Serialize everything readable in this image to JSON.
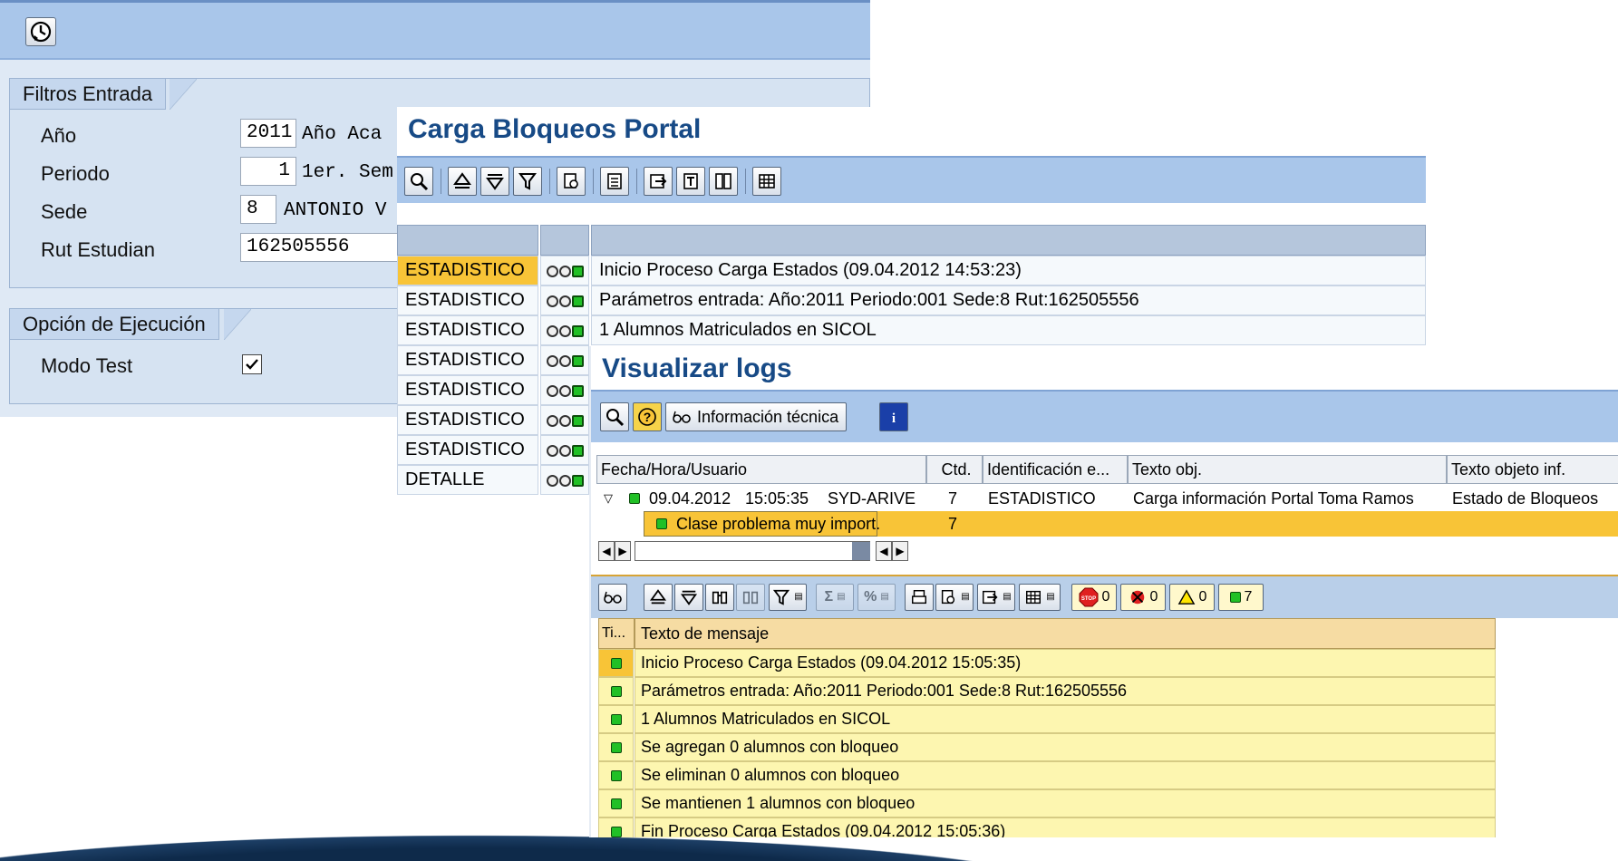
{
  "selection_screen": {
    "group1_title": "Filtros Entrada",
    "fields": [
      {
        "label": "Año",
        "value": "2011",
        "desc": "Año Aca"
      },
      {
        "label": "Periodo",
        "value": "1",
        "desc": "1er. Sem"
      },
      {
        "label": "Sede",
        "value": "8",
        "desc": "ANTONIO V"
      },
      {
        "label": "Rut Estudian",
        "value": "162505556",
        "desc": ""
      }
    ],
    "group2_title": "Opción de Ejecución",
    "mode_label": "Modo Test",
    "mode_checked": true
  },
  "carga": {
    "title": "Carga Bloqueos Portal",
    "rows": [
      {
        "cat": "ESTADISTICO",
        "text": "Inicio Proceso Carga Estados (09.04.2012 14:53:23)",
        "selected": true
      },
      {
        "cat": "ESTADISTICO",
        "text": "Parámetros entrada: Año:2011 Periodo:001 Sede:8 Rut:162505556"
      },
      {
        "cat": "ESTADISTICO",
        "text": "1 Alumnos Matriculados en SICOL"
      },
      {
        "cat": "ESTADISTICO",
        "text": ""
      },
      {
        "cat": "ESTADISTICO",
        "text": ""
      },
      {
        "cat": "ESTADISTICO",
        "text": ""
      },
      {
        "cat": "ESTADISTICO",
        "text": ""
      },
      {
        "cat": "DETALLE",
        "text": ""
      }
    ]
  },
  "logs": {
    "title": "Visualizar logs",
    "tech_info_label": "Información técnica",
    "columns": [
      "Fecha/Hora/Usuario",
      "Ctd.",
      "Identificación e...",
      "Texto obj.",
      "Texto objeto inf."
    ],
    "row1": {
      "date": "09.04.2012",
      "time": "15:05:35",
      "user": "SYD-ARIVE",
      "qty": "7",
      "id": "ESTADISTICO",
      "obj": "Carga información Portal Toma Ramos",
      "objinf": "Estado de Bloqueos"
    },
    "row2": {
      "label": "Clase problema muy import.",
      "qty": "7"
    },
    "counters": {
      "stop": "0",
      "error": "0",
      "warning": "0",
      "success": "7"
    },
    "msg_columns": [
      "Ti...",
      "Texto de mensaje"
    ],
    "messages": [
      "Inicio Proceso Carga Estados (09.04.2012 15:05:35)",
      "Parámetros entrada: Año:2011 Periodo:001 Sede:8 Rut:162505556",
      "1 Alumnos Matriculados en SICOL",
      "Se agregan 0 alumnos con bloqueo",
      "Se eliminan 0 alumnos con bloqueo",
      "Se mantienen 1 alumnos con bloqueo",
      "Fin Proceso Carga Estados (09.04.2012 15:05:36)"
    ]
  },
  "colors": {
    "sap_blue": "#a9c6ea",
    "title_blue": "#174a86",
    "selection_orange": "#f8c437",
    "msg_yellow": "#fdf6b0",
    "success_green": "#21c026"
  }
}
